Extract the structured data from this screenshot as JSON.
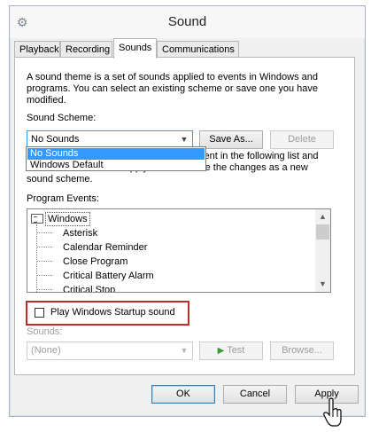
{
  "window": {
    "title": "Sound"
  },
  "tabs": [
    {
      "label": "Playback"
    },
    {
      "label": "Recording"
    },
    {
      "label": "Sounds"
    },
    {
      "label": "Communications"
    }
  ],
  "intro_text": "A sound theme is a set of sounds applied to events in Windows and programs.  You can select an existing scheme or save one you have modified.",
  "scheme": {
    "label": "Sound Scheme:",
    "value": "No Sounds",
    "options": [
      "No Sounds",
      "Windows Default"
    ],
    "save_as_label": "Save As...",
    "delete_label": "Delete"
  },
  "partial_text": {
    "line1": "vent in the following list and",
    "line2": "then select a sound to apply.  You can save the changes as a new",
    "line3": "sound scheme."
  },
  "events": {
    "label": "Program Events:",
    "root": "Windows",
    "items": [
      "Asterisk",
      "Calendar Reminder",
      "Close Program",
      "Critical Battery Alarm",
      "Critical Stop"
    ]
  },
  "startup": {
    "label": "Play Windows Startup sound",
    "checked": false
  },
  "sounds": {
    "label": "Sounds:",
    "value": "(None)",
    "test_label": "Test",
    "browse_label": "Browse..."
  },
  "footer": {
    "ok_label": "OK",
    "cancel_label": "Cancel",
    "apply_label": "Apply"
  },
  "colors": {
    "highlight": "#3399ff",
    "annotation_border": "#b7312c",
    "test_icon": "#3a9d3a"
  },
  "icons": {
    "title": "speaker-gear-icon",
    "dropdown": "chevron-down-icon",
    "test": "play-triangle-icon",
    "cursor": "hand-pointer-icon"
  }
}
